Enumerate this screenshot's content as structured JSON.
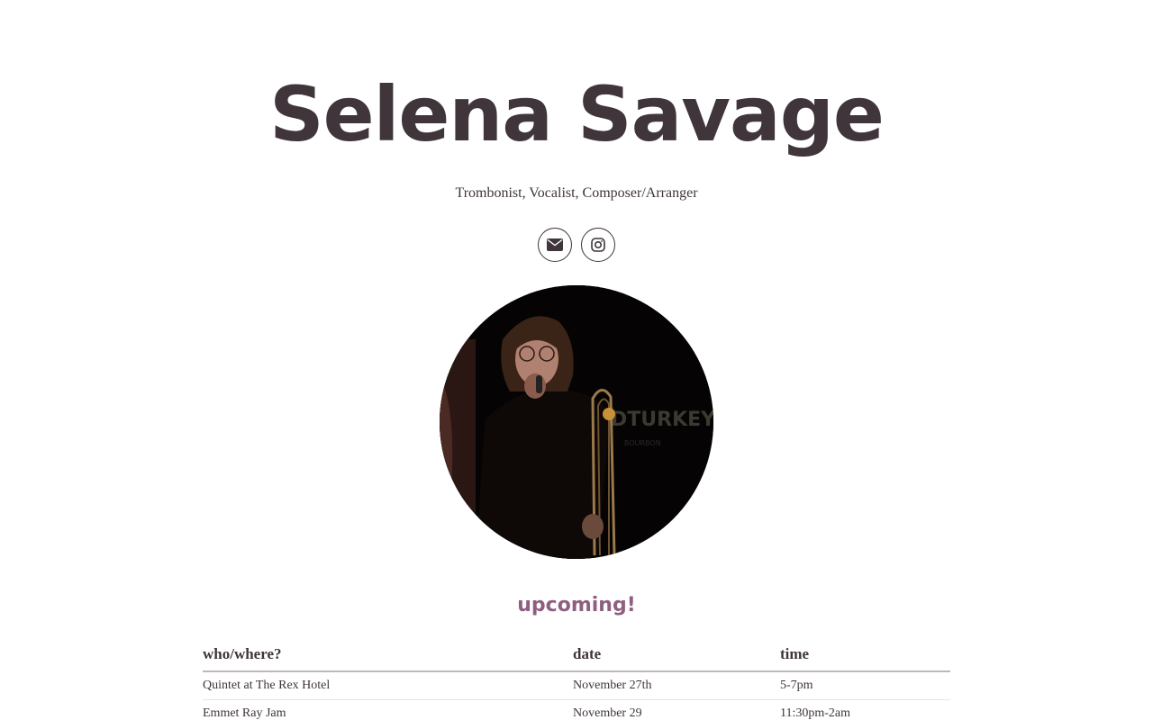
{
  "site": {
    "title": "Selena Savage",
    "tagline": "Trombonist, Vocalist, Composer/Arranger"
  },
  "social": [
    {
      "icon": "envelope-icon"
    },
    {
      "icon": "instagram-icon"
    }
  ],
  "upcoming": {
    "heading": "upcoming!",
    "columns": {
      "who": "who/where?",
      "date": "date",
      "time": "time"
    },
    "rows": [
      {
        "who": "Quintet at The Rex Hotel",
        "date": "November 27th",
        "time": "5-7pm"
      },
      {
        "who": "Emmet Ray Jam",
        "date": "November 29",
        "time": "11:30pm-2am"
      }
    ]
  },
  "colors": {
    "text": "#3f353b",
    "accent": "#8e5f80"
  }
}
